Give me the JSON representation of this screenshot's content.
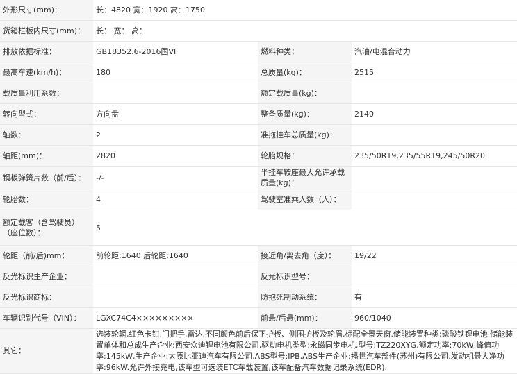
{
  "rows": [
    {
      "l1": "外形尺寸(mm)：",
      "v1": "长：4820 宽：1920 高：1750"
    },
    {
      "l1": "货箱栏板内尺寸(mm)：",
      "v1": "长： 宽： 高："
    },
    {
      "l1": "排放依据标准：",
      "v1": "GB18352.6-2016国VI",
      "l2": "燃料种类：",
      "v2": "汽油/电混合动力"
    },
    {
      "l1": "最高车速(km/h)：",
      "v1": "180",
      "l2": "总质量(kg)：",
      "v2": "2515"
    },
    {
      "l1": "载质量利用系数：",
      "v1": "",
      "l2": "额定载质量(kg)：",
      "v2": ""
    },
    {
      "l1": "转向型式：",
      "v1": "方向盘",
      "l2": "整备质量(kg)：",
      "v2": "2140"
    },
    {
      "l1": "轴数：",
      "v1": "2",
      "l2": "准拖挂车总质量(kg)：",
      "v2": ""
    },
    {
      "l1": "轴距(mm)：",
      "v1": "2820",
      "l2": "轮胎规格：",
      "v2": "235/50R19,235/55R19,245/50R20"
    },
    {
      "l1": "钢板弹簧片数（前/后）：",
      "v1": "-/-",
      "l2": "半挂车鞍座最大允许承载质量(kg)：",
      "v2": ""
    },
    {
      "l1": "轮胎数：",
      "v1": "4",
      "l2": "驾驶室准乘人数（人）：",
      "v2": ""
    },
    {
      "l1": "额定载客（含驾驶员）（座位数）：",
      "v1": "5"
    },
    {
      "l1": "轮距（前/后)mm：",
      "v1": "前轮距:1640 后轮距:1640",
      "l2": "接近角/离去角（度）：",
      "v2": "19/22"
    },
    {
      "l1": "反光标识生产企业：",
      "v1": "",
      "l2": "反光标识型号：",
      "v2": ""
    },
    {
      "l1": "反光标识商标：",
      "v1": "",
      "l2": "防抱死制动系统：",
      "v2": "有"
    },
    {
      "l1": "车辆识别代号（VIN）：",
      "v1": "LGXC74C4×××××××××",
      "l2": "前悬/后悬(mm)：",
      "v2": "960/1040"
    },
    {
      "l1": "其它：",
      "v1": "选装轮辋,红色卡钳,门把手,雷达,不同颜色前后保下护板、侧围护板及轮眉,标配全景天窗.储能装置种类:磷酸铁锂电池,储能装置单体和总成生产企业:西安众迪锂电池有限公司,驱动电机类型:永磁同步电机,型号:TZ220XYG,额定功率:70kW,峰值功率:145kW,生产企业:太原比亚迪汽车有限公司,ABS型号:IPB,ABS生产企业:播世汽车部件(苏州)有限公司.发动机最大净功率:96kW.允许外接充电,该车型可选装ETC车载装置,该车配备汽车数据记录系统(EDR)."
    }
  ]
}
